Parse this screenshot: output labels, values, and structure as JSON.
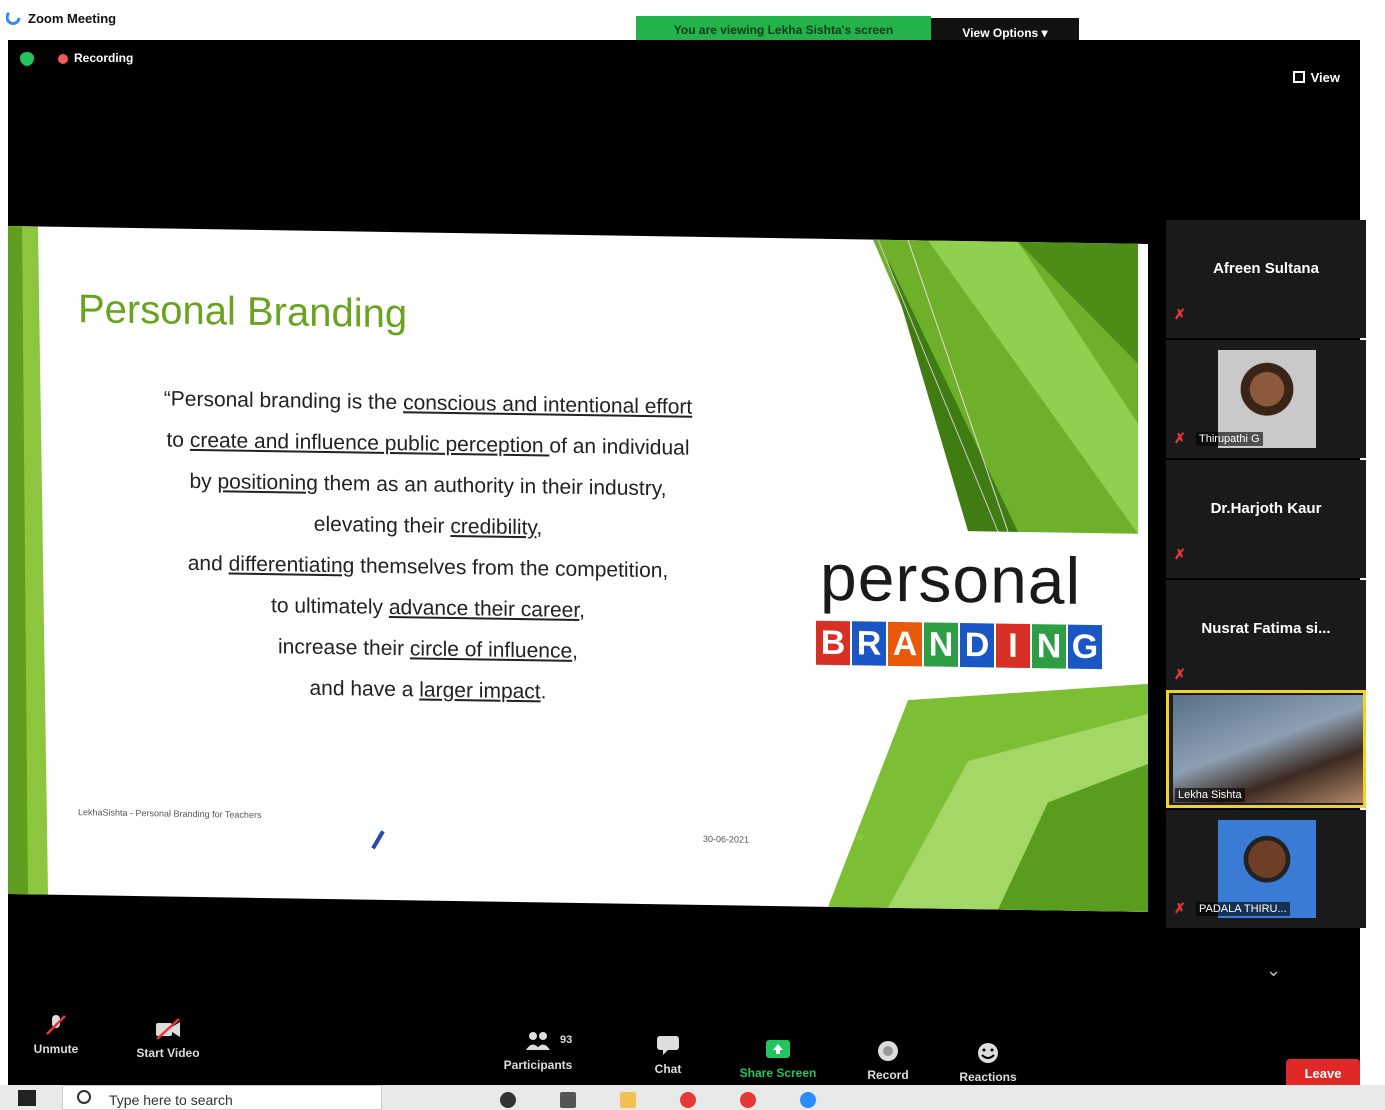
{
  "window": {
    "title": "Zoom Meeting",
    "banner": "You are viewing Lekha Sishta's screen",
    "view_options": "View Options ▾"
  },
  "meeting": {
    "recording_label": "Recording",
    "view_label": "View"
  },
  "slide": {
    "title": "Personal Branding",
    "quote_lines": [
      [
        "“Personal branding is the ",
        {
          "u": "conscious and intentional effort"
        }
      ],
      [
        "to ",
        {
          "u": "create and influence public perception "
        },
        "of an individual"
      ],
      [
        "by ",
        {
          "u": "positioning"
        },
        " them as an authority in their industry,"
      ],
      [
        "elevating their ",
        {
          "u": "credibility"
        },
        ","
      ],
      [
        "and ",
        {
          "u": "differentiating"
        },
        " themselves from the competition,"
      ],
      [
        "to ultimately ",
        {
          "u": "advance their career"
        },
        ","
      ],
      [
        "increase their ",
        {
          "u": "circle of influence"
        },
        ","
      ],
      [
        "and have a ",
        {
          "u": "larger impact"
        },
        "."
      ]
    ],
    "word_personal": "personal",
    "branding_letters": [
      "B",
      "R",
      "A",
      "N",
      "D",
      "I",
      "N",
      "G"
    ],
    "branding_colors": [
      "#d93025",
      "#1a56c4",
      "#e8590c",
      "#2e9e44",
      "#1a56c4",
      "#d93025",
      "#2e9e44",
      "#1a56c4"
    ],
    "footer_left": "LekhaSishta - Personal Branding for Teachers",
    "footer_date": "30-06-2021"
  },
  "participants": [
    {
      "name": "Afreen Sultana",
      "has_video": false
    },
    {
      "name": "Thirupathi G",
      "has_video": true
    },
    {
      "name": "Dr.Harjoth Kaur",
      "has_video": false
    },
    {
      "name": "Nusrat Fatima si...",
      "has_video": false
    },
    {
      "name": "Lekha Sishta",
      "has_video": true,
      "active": true
    },
    {
      "name": "PADALA THIRU...",
      "has_video": true
    }
  ],
  "toolbar": {
    "unmute": "Unmute",
    "start_video": "Start Video",
    "participants": "Participants",
    "participants_count": "93",
    "chat": "Chat",
    "share_screen": "Share Screen",
    "record": "Record",
    "reactions": "Reactions",
    "leave": "Leave"
  },
  "taskbar": {
    "search_placeholder": "Type here to search"
  },
  "colors": {
    "banner_green": "#24b24b",
    "slide_title_green": "#6aa320",
    "share_green": "#22c55e",
    "leave_red": "#e02828",
    "active_speaker": "#f2d322"
  }
}
